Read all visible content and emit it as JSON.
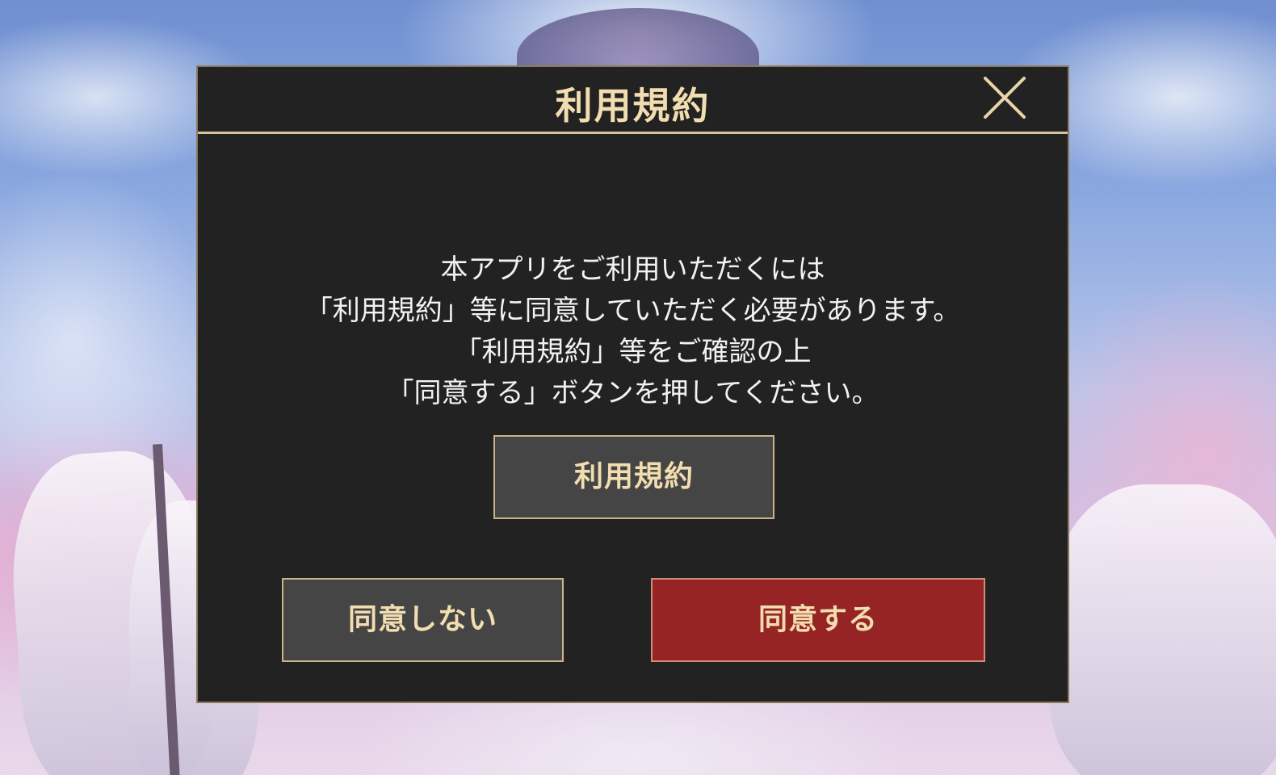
{
  "dialog": {
    "title": "利用規約",
    "close_icon": "close-icon",
    "message_lines": [
      "本アプリをご利用いただくには",
      "「利用規約」等に同意していただく必要があります。",
      "「利用規約」等をご確認の上",
      "「同意する」ボタンを押してください。"
    ],
    "terms_button_label": "利用規約",
    "decline_button_label": "同意しない",
    "agree_button_label": "同意する"
  },
  "colors": {
    "dialog_background": "#222222",
    "title_gold": "#f2ddb0",
    "agree_red": "#962424",
    "button_gray": "#454545"
  }
}
